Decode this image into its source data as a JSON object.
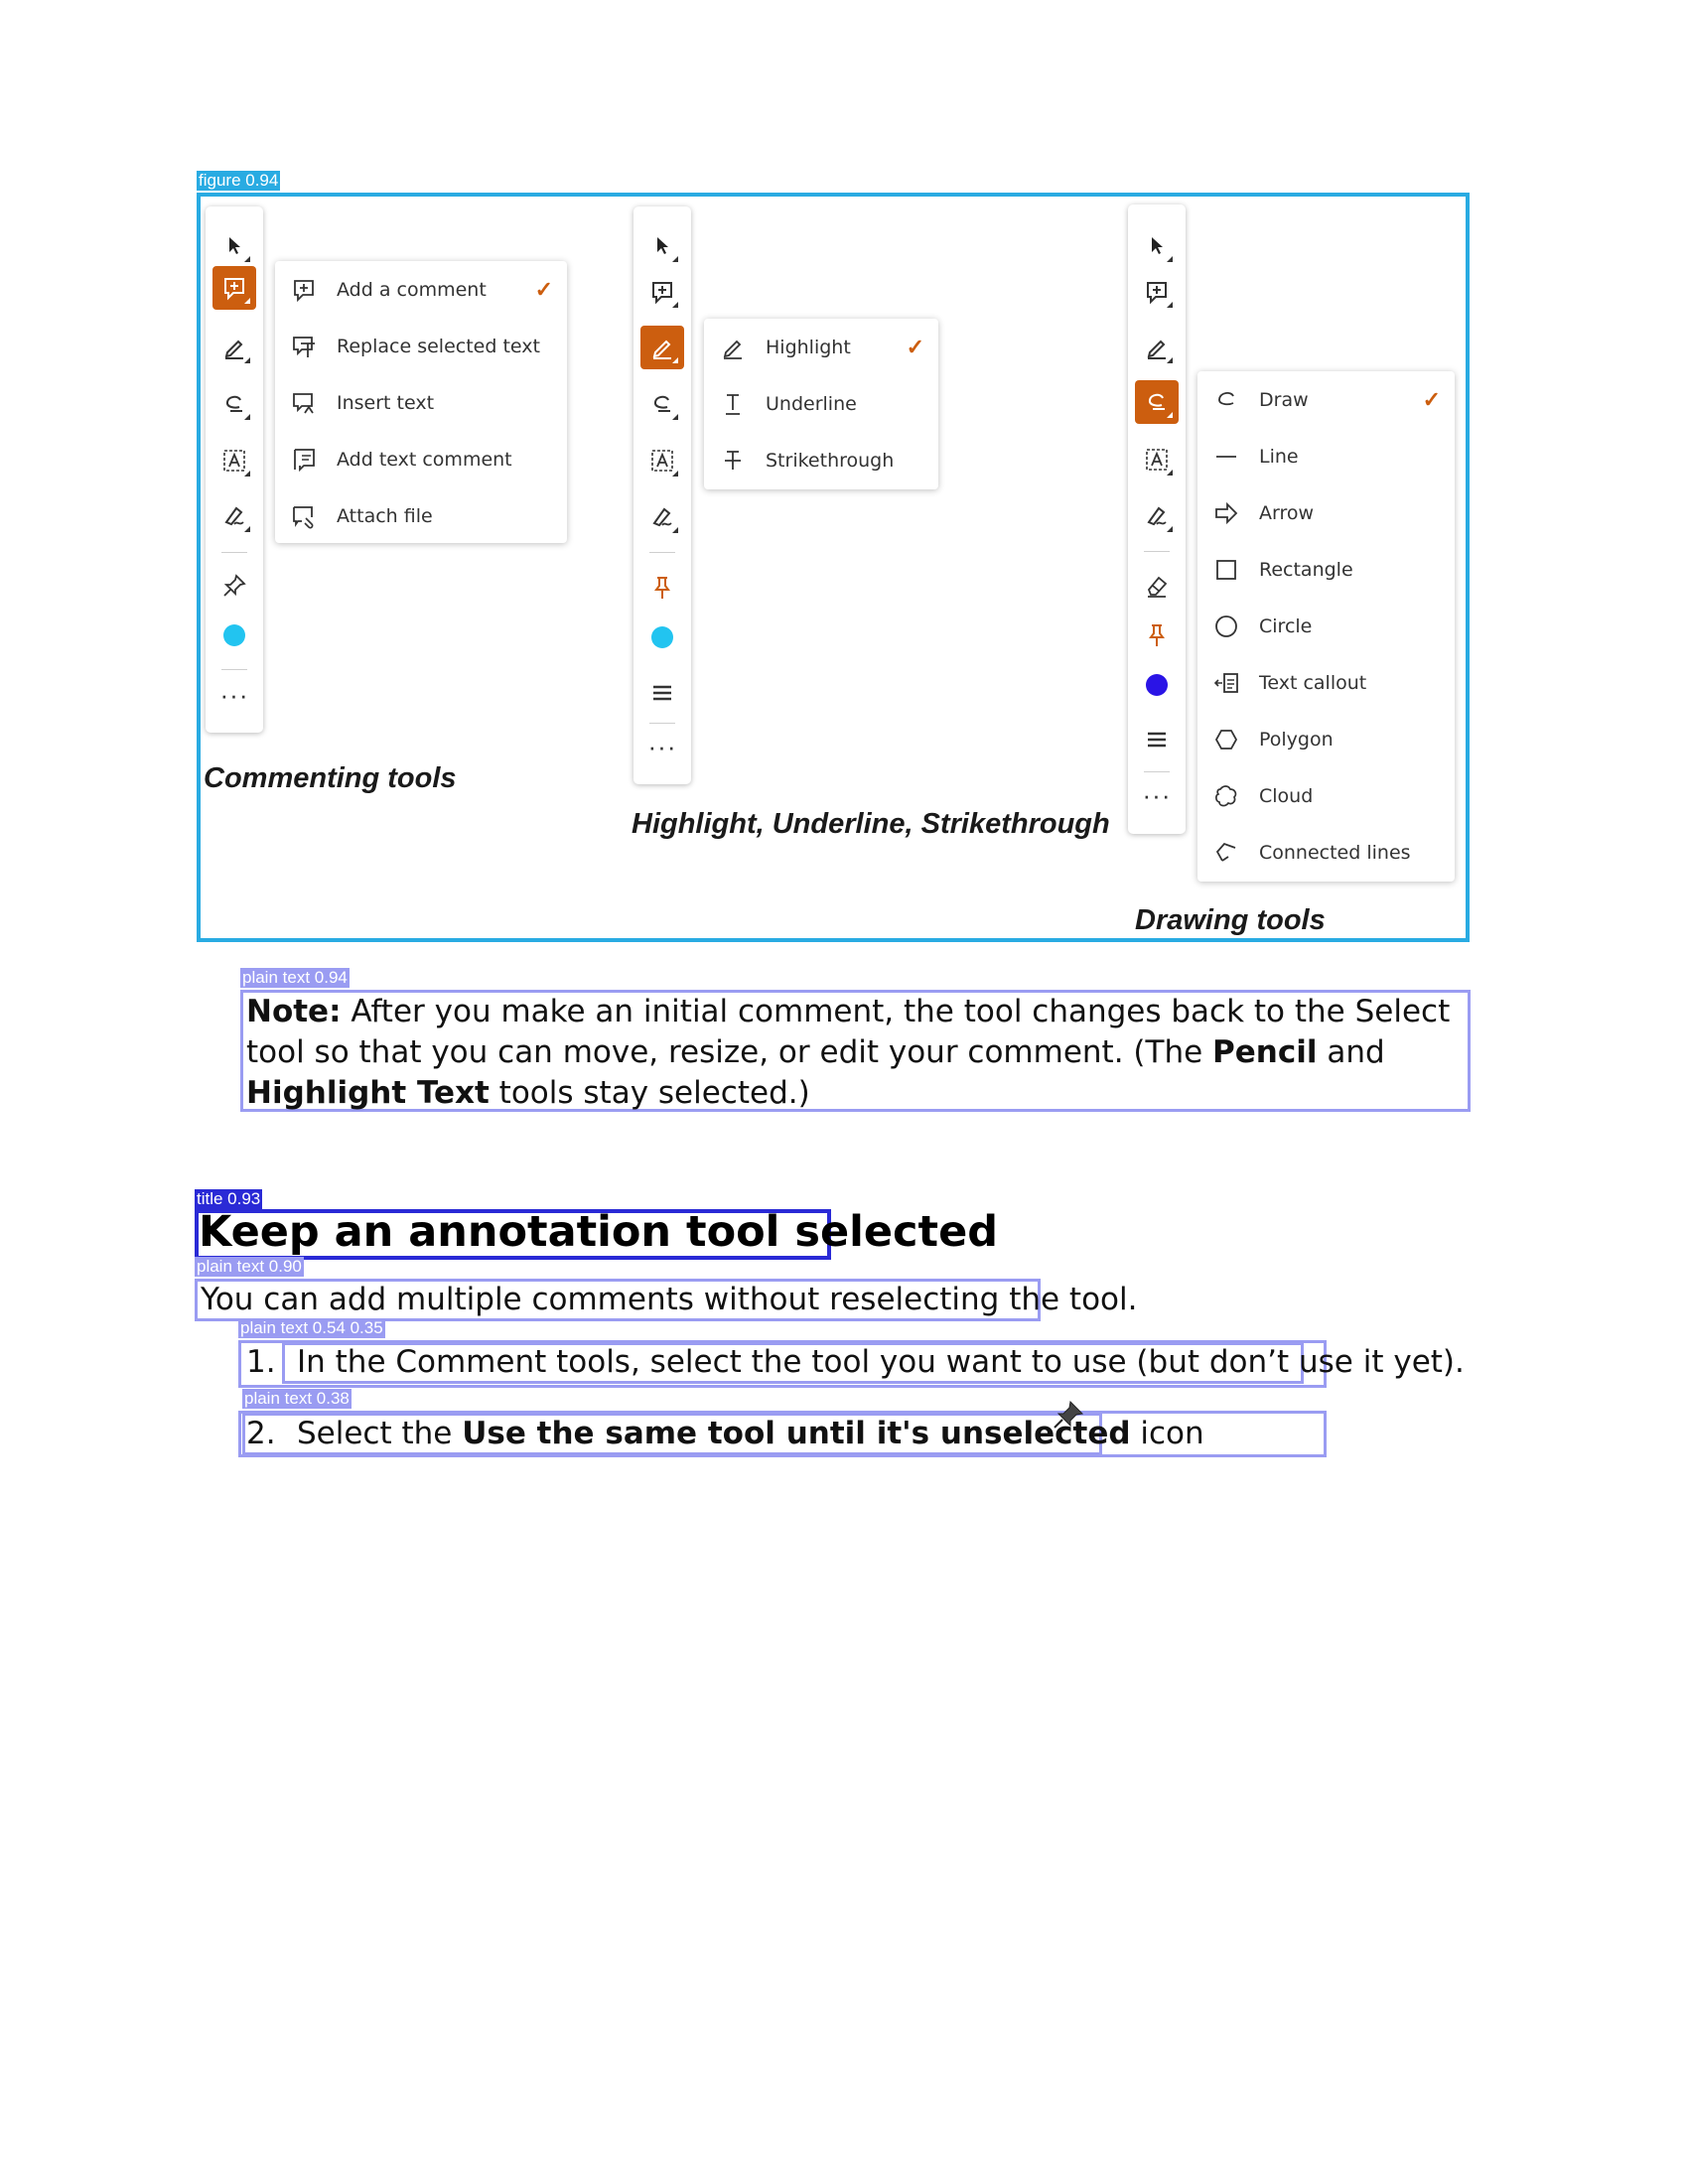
{
  "detections": {
    "figure": "figure 0.94",
    "note": "plain text 0.94",
    "title": "title 0.93",
    "intro": "plain text 0.90",
    "step1": "plain text 0.54 0.35",
    "step2": "plain text 0.38"
  },
  "colors": {
    "figure_box": "#29abe2",
    "text_box": "#9a9cf2",
    "title_box": "#2a2ad6",
    "accent": "#cc5e0f",
    "cyan_dot": "#22c4f0",
    "blue_dot": "#2a14e6"
  },
  "menus": {
    "commenting": [
      {
        "icon": "comment-plus-icon",
        "label": "Add a comment",
        "checked": true
      },
      {
        "icon": "replace-text-icon",
        "label": "Replace selected text",
        "checked": false
      },
      {
        "icon": "insert-text-icon",
        "label": "Insert text",
        "checked": false
      },
      {
        "icon": "text-comment-icon",
        "label": "Add text comment",
        "checked": false
      },
      {
        "icon": "attach-file-icon",
        "label": "Attach file",
        "checked": false
      }
    ],
    "highlight": [
      {
        "icon": "highlight-pen-icon",
        "label": "Highlight",
        "checked": true
      },
      {
        "icon": "underline-icon",
        "label": "Underline",
        "checked": false
      },
      {
        "icon": "strikethrough-icon",
        "label": "Strikethrough",
        "checked": false
      }
    ],
    "drawing": [
      {
        "icon": "draw-icon",
        "label": "Draw",
        "checked": true
      },
      {
        "icon": "line-icon",
        "label": "Line",
        "checked": false
      },
      {
        "icon": "arrow-icon",
        "label": "Arrow",
        "checked": false
      },
      {
        "icon": "rectangle-icon",
        "label": "Rectangle",
        "checked": false
      },
      {
        "icon": "circle-icon",
        "label": "Circle",
        "checked": false
      },
      {
        "icon": "text-callout-icon",
        "label": "Text callout",
        "checked": false
      },
      {
        "icon": "polygon-icon",
        "label": "Polygon",
        "checked": false
      },
      {
        "icon": "cloud-icon",
        "label": "Cloud",
        "checked": false
      },
      {
        "icon": "connected-lines-icon",
        "label": "Connected lines",
        "checked": false
      }
    ]
  },
  "captions": {
    "commenting": "Commenting tools",
    "highlight": "Highlight, Underline, Strikethrough",
    "drawing": "Drawing tools"
  },
  "note": {
    "lead": "Note:",
    "t1": " After you make an initial comment, the tool changes back to the Select tool so that you can move, resize, or edit your comment. (The ",
    "b1": "Pencil",
    "t2": " and ",
    "b2": "Highlight Text",
    "t3": " tools stay selected.)"
  },
  "heading": "Keep an annotation tool selected",
  "intro": "You can add multiple comments without reselecting the tool.",
  "steps": {
    "s1_num": "1.",
    "s1_text": "In the Comment tools, select the tool you want to use (but don’t use it yet).",
    "s2_num": "2.",
    "s2_t1": "Select the ",
    "s2_bold": "Use the same tool until it's unselected",
    "s2_t2": " icon"
  }
}
